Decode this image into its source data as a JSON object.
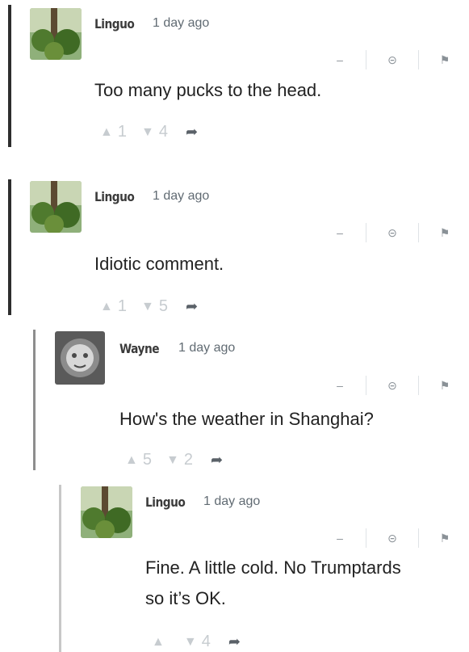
{
  "colors": {
    "rail_top": "#2e2e2e",
    "rail_nested": "#8d8d8d",
    "rail_deep": "#c7c7c7",
    "muted": "#c7ccd0"
  },
  "icons": {
    "collapse": "minus-icon",
    "link": "link-icon",
    "flag": "flag-icon",
    "upvote": "triangle-up-icon",
    "downvote": "triangle-down-icon",
    "reply": "reply-arrow-icon"
  },
  "tool_labels": {
    "collapse": "–",
    "link": "⊝",
    "flag": "⚑"
  },
  "comments": [
    {
      "author": "Linguo",
      "time": "1 day ago",
      "text": [
        "Too many pucks to the head."
      ],
      "up": "1",
      "down": "4"
    },
    {
      "author": "Linguo",
      "time": "1 day ago",
      "text": [
        "Idiotic comment."
      ],
      "up": "1",
      "down": "5"
    },
    {
      "author": "Wayne",
      "time": "1 day ago",
      "text": [
        "How's the weather in Shanghai?"
      ],
      "up": "5",
      "down": "2"
    },
    {
      "author": "Linguo",
      "time": "1 day ago",
      "text": [
        "Fine. A little cold. No Trumptards",
        "so it’s OK."
      ],
      "up": "",
      "down": "4"
    }
  ]
}
